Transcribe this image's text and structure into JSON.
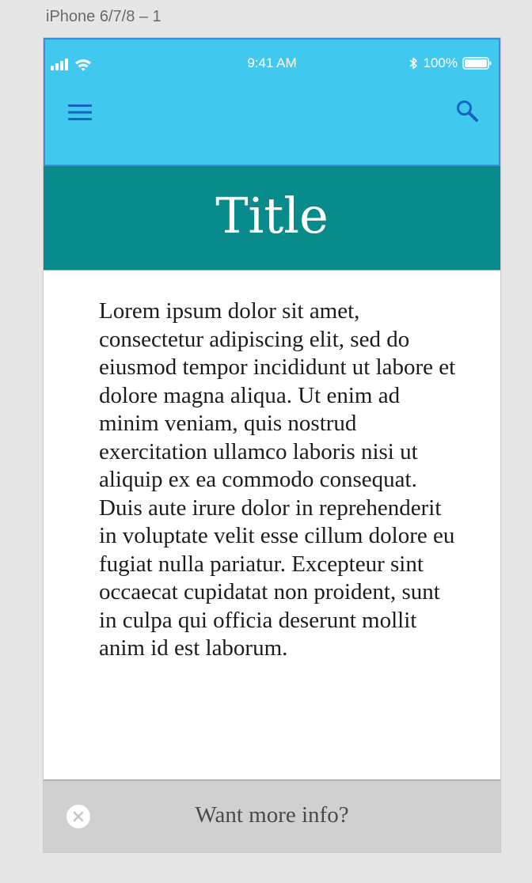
{
  "artboard": {
    "label": "iPhone 6/7/8 – 1"
  },
  "status_bar": {
    "time": "9:41 AM",
    "battery": "100%",
    "icons": [
      "signal-icon",
      "wifi-icon",
      "bluetooth-icon",
      "battery-icon"
    ]
  },
  "app_bar": {
    "menu_icon": "hamburger-menu-icon",
    "search_icon": "search-icon",
    "color": "#41c8ee"
  },
  "banner": {
    "title": "Title",
    "color": "#0a8b8b"
  },
  "content": {
    "body": "Lorem ipsum dolor sit amet, consectetur adipiscing elit, sed do eiusmod tempor incididunt ut labore et dolore magna aliqua. Ut enim ad minim veniam, quis nostrud exercitation ullamco laboris nisi ut aliquip ex ea commodo consequat. Duis aute irure dolor in reprehenderit in voluptate velit esse cillum dolore eu fugiat nulla pariatur. Excepteur sint occaecat cupidatat non proident, sunt in culpa qui officia deserunt mollit anim id est laborum."
  },
  "info_bar": {
    "text": "Want more info?",
    "close_icon": "close-circle-icon"
  }
}
